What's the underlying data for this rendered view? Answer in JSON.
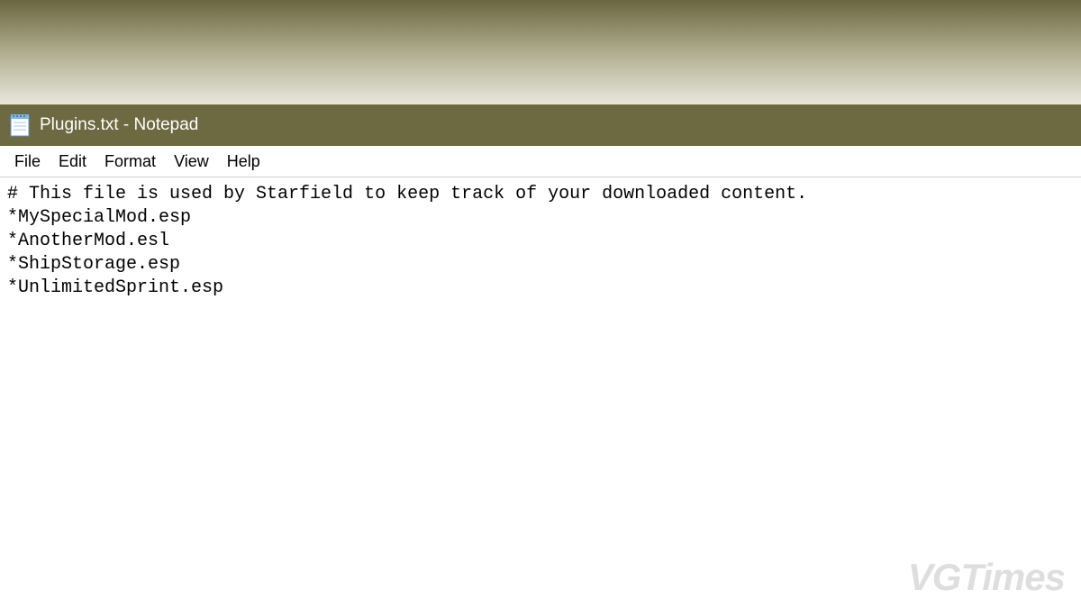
{
  "titlebar": {
    "title": "Plugins.txt - Notepad"
  },
  "menu": {
    "items": [
      "File",
      "Edit",
      "Format",
      "View",
      "Help"
    ]
  },
  "editor": {
    "lines": [
      "# This file is used by Starfield to keep track of your downloaded content.",
      "*MySpecialMod.esp",
      "*AnotherMod.esl",
      "*ShipStorage.esp",
      "*UnlimitedSprint.esp"
    ]
  },
  "watermark": "VGTimes"
}
